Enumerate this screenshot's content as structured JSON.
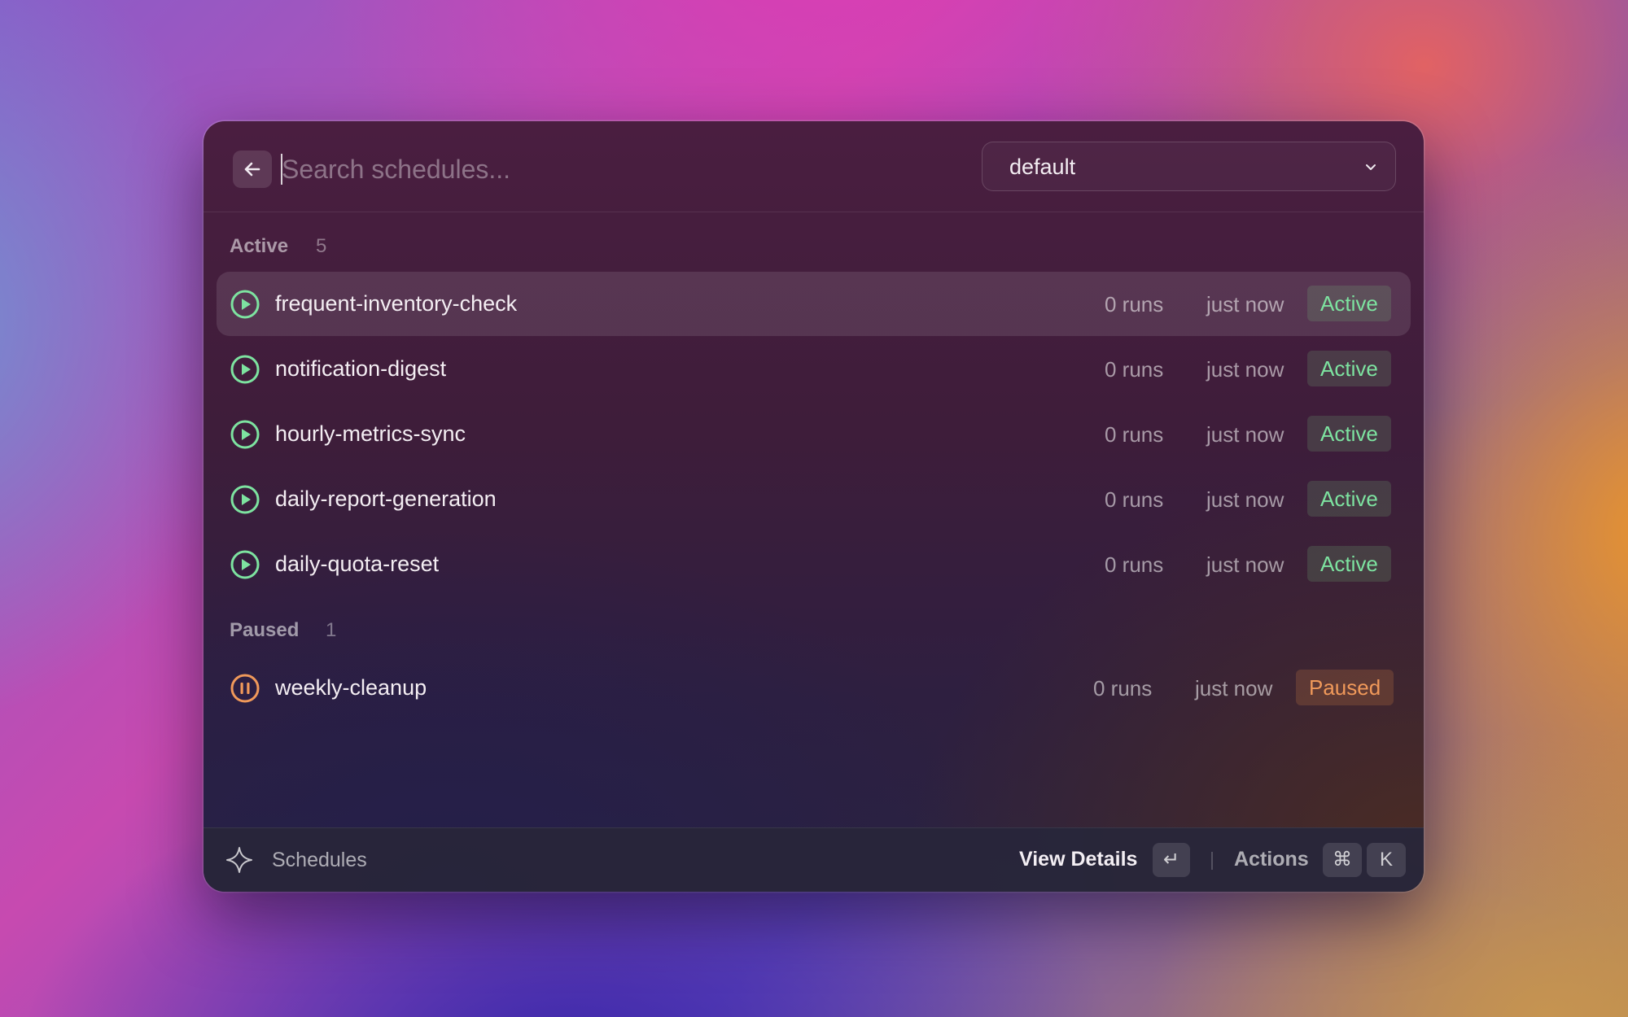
{
  "search": {
    "placeholder": "Search schedules...",
    "value": ""
  },
  "namespace_select": {
    "selected": "default"
  },
  "sections": {
    "active": {
      "title": "Active",
      "count": "5",
      "rows": [
        {
          "name": "frequent-inventory-check",
          "runs": "0 runs",
          "last": "just now",
          "status": "Active"
        },
        {
          "name": "notification-digest",
          "runs": "0 runs",
          "last": "just now",
          "status": "Active"
        },
        {
          "name": "hourly-metrics-sync",
          "runs": "0 runs",
          "last": "just now",
          "status": "Active"
        },
        {
          "name": "daily-report-generation",
          "runs": "0 runs",
          "last": "just now",
          "status": "Active"
        },
        {
          "name": "daily-quota-reset",
          "runs": "0 runs",
          "last": "just now",
          "status": "Active"
        }
      ]
    },
    "paused": {
      "title": "Paused",
      "count": "1",
      "rows": [
        {
          "name": "weekly-cleanup",
          "runs": "0 runs",
          "last": "just now",
          "status": "Paused"
        }
      ]
    }
  },
  "footer": {
    "title": "Schedules",
    "primary_action": "View Details",
    "primary_key": "↵",
    "actions_label": "Actions",
    "actions_keys": [
      "⌘",
      "K"
    ]
  },
  "colors": {
    "active_accent": "#7de3a0",
    "paused_accent": "#f0995a"
  },
  "icons": {
    "back": "arrow-left-icon",
    "dropdown": "chevron-down-icon",
    "active_row": "play-circle-icon",
    "paused_row": "pause-circle-icon",
    "footer": "sparkle-icon"
  }
}
